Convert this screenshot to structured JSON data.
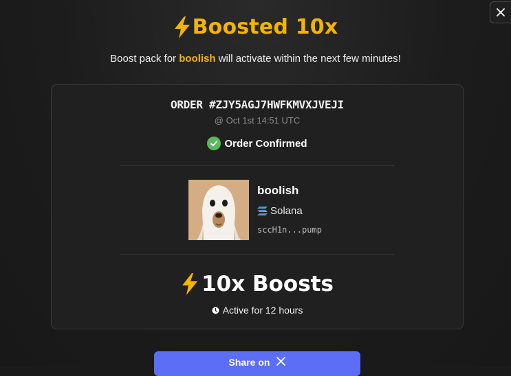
{
  "header": {
    "title": "Boosted 10x",
    "subtitle_prefix": "Boost pack for",
    "subtitle_token": "boolish",
    "subtitle_suffix": "will activate within the next few minutes!"
  },
  "order": {
    "id_text": "ORDER #ZJY5AGJ7HWFKMVXJVEJI",
    "date_text": "@ Oct 1st 14:51 UTC",
    "status_text": "Order Confirmed"
  },
  "token": {
    "name": "boolish",
    "chain": "Solana",
    "address": "sccH1n...pump",
    "image_icon": "ghost-dog-avatar"
  },
  "boost": {
    "title": "10x Boosts",
    "duration_text": "Active for 12 hours"
  },
  "share": {
    "label": "Share on",
    "icon": "x-logo-icon"
  },
  "colors": {
    "accent": "#f5b400",
    "confirm": "#5cb85c",
    "button": "#5b6ef5"
  }
}
